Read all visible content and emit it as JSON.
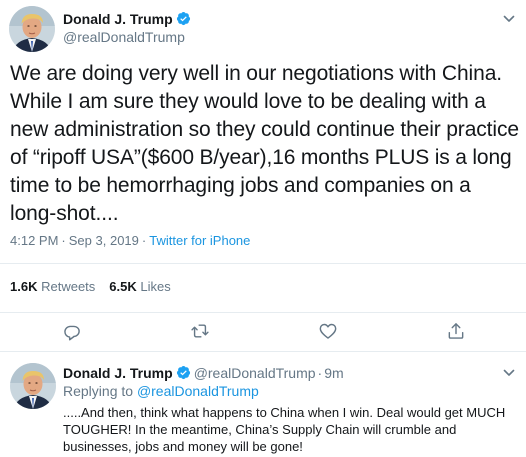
{
  "tweet": {
    "author_name": "Donald J. Trump",
    "author_handle": "@realDonaldTrump",
    "text": "We are doing very well in our negotiations with China. While I am sure they would love to be dealing with a new administration so they could continue their practice of “ripoff USA”($600 B/year),16 months PLUS is a long time to be hemorrhaging jobs and companies on a long-shot....",
    "time": "4:12 PM",
    "separator": "·",
    "date": "Sep 3, 2019",
    "source": "Twitter for iPhone",
    "stats": {
      "retweets_count": "1.6K",
      "retweets_label": "Retweets",
      "likes_count": "6.5K",
      "likes_label": "Likes"
    },
    "icons": {
      "verified": "verified-badge-icon",
      "menu": "chevron-down-icon",
      "reply": "reply-icon",
      "retweet": "retweet-icon",
      "like": "heart-icon",
      "share": "share-icon"
    }
  },
  "reply": {
    "author_name": "Donald J. Trump",
    "author_handle": "@realDonaldTrump",
    "separator": "·",
    "time": "9m",
    "replying_label": "Replying to",
    "replying_mention": "@realDonaldTrump",
    "text": ".....And then, think what happens to China when I win. Deal would get MUCH TOUGHER! In the meantime, China’s Supply Chain will crumble and businesses, jobs and money will be gone!"
  },
  "colors": {
    "text": "#14171a",
    "secondary": "#657786",
    "link": "#1b95e0",
    "verified": "#1da1f2",
    "divider": "#e6ecf0"
  }
}
